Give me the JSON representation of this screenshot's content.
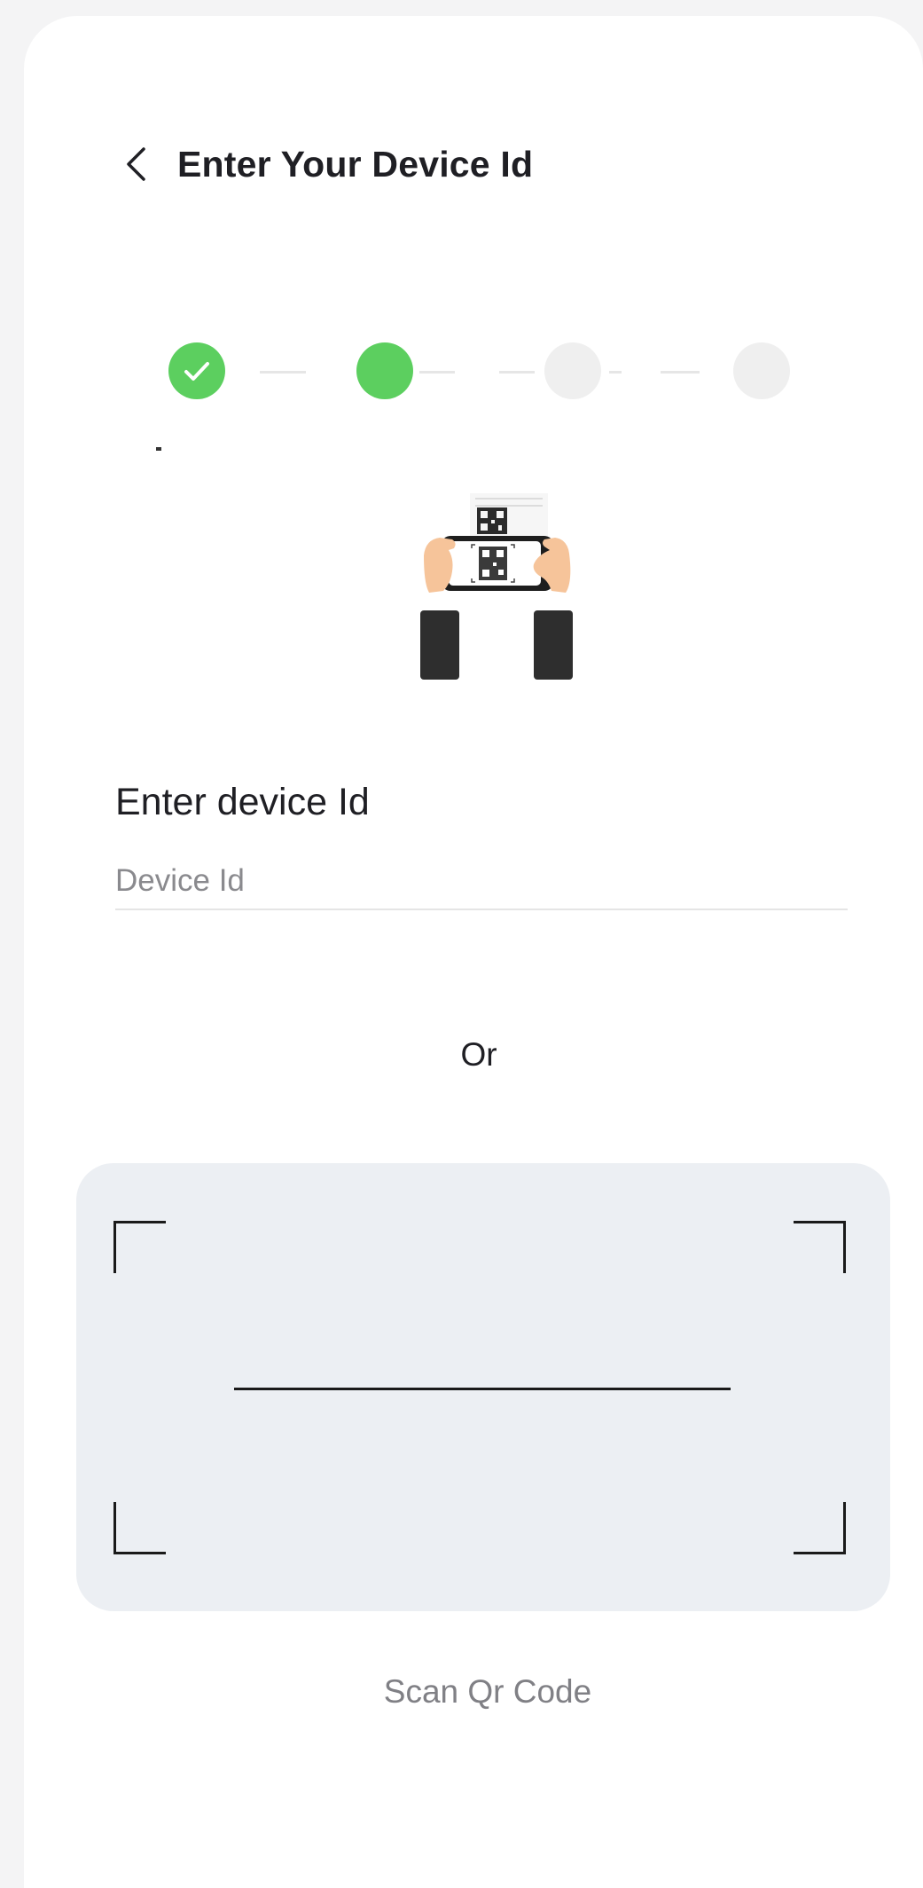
{
  "header": {
    "title": "Enter Your Device Id",
    "back_icon": "chevron-left-icon"
  },
  "stepper": {
    "steps": [
      {
        "state": "completed",
        "icon": "check-icon"
      },
      {
        "state": "active"
      },
      {
        "state": "pending"
      },
      {
        "state": "pending"
      }
    ],
    "colors": {
      "complete": "#5ccf5f",
      "pending": "#efefef"
    }
  },
  "illustration": {
    "icon": "qr-scan-hands-illustration"
  },
  "device_form": {
    "label": "Enter device Id",
    "placeholder": "Device Id",
    "value": ""
  },
  "separator": {
    "text": "Or"
  },
  "scanner": {
    "label": "Scan Qr Code",
    "icon": "qr-viewfinder-icon",
    "background": "#eceff3"
  }
}
